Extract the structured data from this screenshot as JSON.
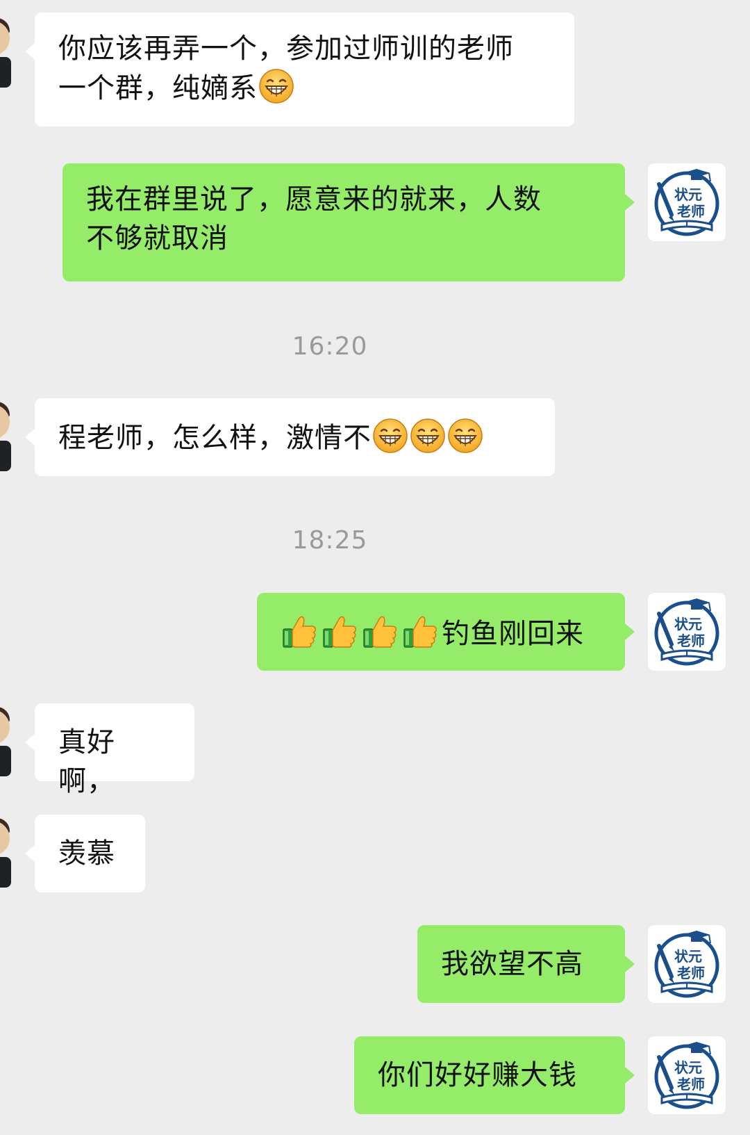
{
  "messages": [
    {
      "side": "in",
      "text": "你应该再弄一个，参加过师训的老师一个群，纯嫡系",
      "line1": "你应该再弄一个，参加过师训的老师",
      "line2": "一个群，纯嫡系",
      "emojis": [
        "grin-emoji"
      ]
    },
    {
      "side": "out",
      "line1": "我在群里说了，愿意来的就来，人数",
      "line2": "不够就取消"
    },
    {
      "type": "time",
      "text": "16:20"
    },
    {
      "side": "in",
      "text": "程老师，怎么样，激情不",
      "emojis": [
        "grin-emoji",
        "grin-emoji",
        "grin-emoji"
      ]
    },
    {
      "type": "time",
      "text": "18:25"
    },
    {
      "side": "out",
      "text": "钓鱼刚回来",
      "emojis": [
        "thumbs-up-emoji",
        "thumbs-up-emoji",
        "thumbs-up-emoji",
        "thumbs-up-emoji"
      ]
    },
    {
      "side": "in",
      "text": "真好啊，"
    },
    {
      "side": "in",
      "text": "羡慕"
    },
    {
      "side": "out",
      "text": "我欲望不高"
    },
    {
      "side": "out",
      "text": "你们好好赚大钱"
    }
  ],
  "self_avatar": {
    "line1": "状元",
    "line2": "老师",
    "icon": "graduation-cap-book-logo"
  },
  "colors": {
    "background": "#ededed",
    "incoming_bubble": "#ffffff",
    "outgoing_bubble": "#95ec69",
    "timestamp": "#9a9a9a",
    "logo_blue": "#1a4f8c"
  }
}
